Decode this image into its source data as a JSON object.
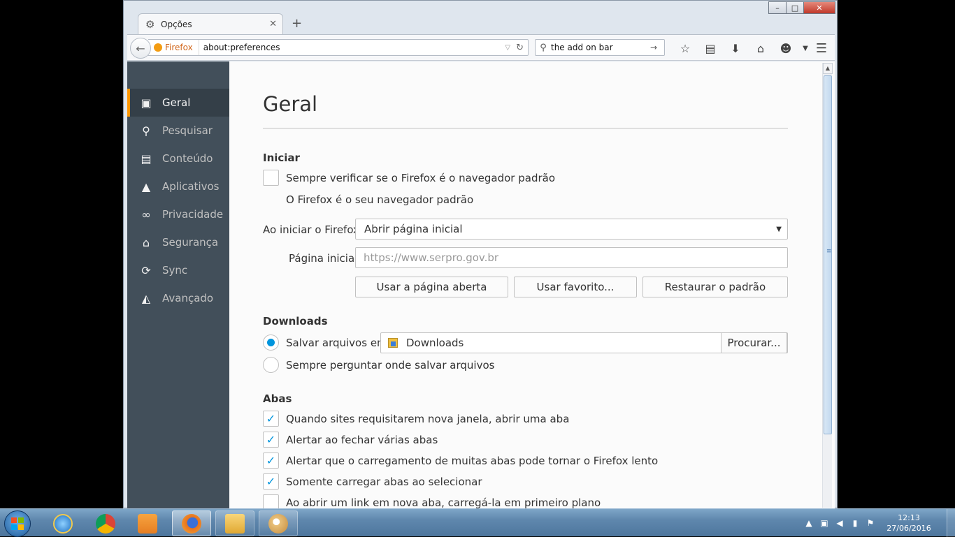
{
  "window": {
    "controls": {
      "minimize": "–",
      "maximize": "□",
      "close": "✕"
    }
  },
  "tab": {
    "title": "Opções",
    "icon": "gear-icon",
    "close": "✕",
    "new_tab": "+"
  },
  "navbar": {
    "identity": "Firefox",
    "url": "about:preferences",
    "search_text": "the add on bar"
  },
  "sidebar": {
    "items": [
      {
        "label": "Geral",
        "icon": "general-icon",
        "selected": true
      },
      {
        "label": "Pesquisar",
        "icon": "search-icon"
      },
      {
        "label": "Conteúdo",
        "icon": "content-icon"
      },
      {
        "label": "Aplicativos",
        "icon": "applications-icon"
      },
      {
        "label": "Privacidade",
        "icon": "privacy-mask-icon"
      },
      {
        "label": "Segurança",
        "icon": "security-icon"
      },
      {
        "label": "Sync",
        "icon": "sync-icon"
      },
      {
        "label": "Avançado",
        "icon": "advanced-icon"
      }
    ]
  },
  "main": {
    "title": "Geral",
    "startup": {
      "heading": "Iniciar",
      "default_check": "Sempre verificar se o Firefox é o navegador padrão",
      "default_status": "O Firefox é o seu navegador padrão",
      "on_start_label": "Ao iniciar o Firefox:",
      "on_start_value": "Abrir página inicial",
      "home_label": "Página inicial:",
      "home_placeholder": "https://www.serpro.gov.br",
      "btn_current": "Usar a página aberta",
      "btn_bookmark": "Usar favorito...",
      "btn_restore": "Restaurar o padrão"
    },
    "downloads": {
      "heading": "Downloads",
      "save_to_label": "Salvar arquivos em:",
      "folder": "Downloads",
      "browse": "Procurar...",
      "always_ask": "Sempre perguntar onde salvar arquivos"
    },
    "tabs": {
      "heading": "Abas",
      "options": [
        {
          "label": "Quando sites requisitarem nova janela, abrir uma aba",
          "checked": true
        },
        {
          "label": "Alertar ao fechar várias abas",
          "checked": true
        },
        {
          "label": "Alertar que o carregamento de muitas abas pode tornar o Firefox lento",
          "checked": true
        },
        {
          "label": "Somente carregar abas ao selecionar",
          "checked": true
        },
        {
          "label": "Ao abrir um link em nova aba, carregá-la em primeiro plano",
          "checked": false
        }
      ]
    }
  },
  "taskbar": {
    "time": "12:13",
    "date": "27/06/2016"
  },
  "colors": {
    "accent": "#ff9500",
    "checkmark": "#0095dd",
    "sidebar_bg": "#424f5a"
  }
}
